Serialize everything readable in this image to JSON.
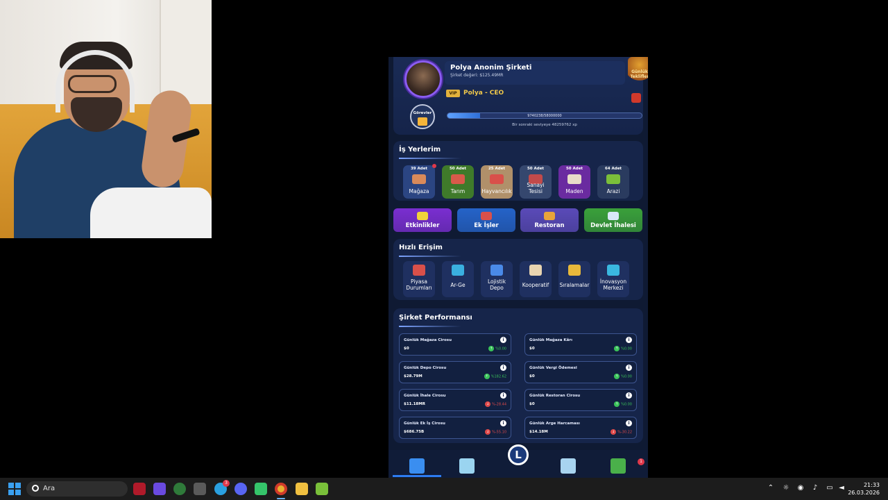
{
  "game": {
    "company_name": "Polya Anonim Şirketi",
    "company_value": "Şirket değeri: $125.49MR",
    "vip": "VIP",
    "ceo": "Polya - CEO",
    "daily_offers": "Günlük Teklifler",
    "tasks": "Görevler",
    "xp_progress": "9740238/58000000",
    "xp_fill_fraction": 0.168,
    "xp_next": "Bir sonraki seviyeye 48259762 xp",
    "workplaces_title": "İş Yerlerim",
    "workplaces": [
      {
        "count": "39 Adet",
        "label": "Mağaza",
        "color": "#2b4582",
        "icon_color": "#d98a5a",
        "alert": true
      },
      {
        "count": "50 Adet",
        "label": "Tarım",
        "color": "#3f7a2a",
        "icon_color": "#d95a4a",
        "alert": false
      },
      {
        "count": "25 Adet",
        "label": "Hayvancılık",
        "color": "#b0906a",
        "icon_color": "#d9504a",
        "alert": false
      },
      {
        "count": "50 Adet",
        "label": "Sanayi Tesisi",
        "color": "#35476e",
        "icon_color": "#c24a4a",
        "alert": false
      },
      {
        "count": "50 Adet",
        "label": "Maden",
        "color": "#6a2ba0",
        "icon_color": "#e8dcc8",
        "alert": false
      },
      {
        "count": "64 Adet",
        "label": "Arazi",
        "color": "#2a3b5f",
        "icon_color": "#7bbf3a",
        "alert": false
      }
    ],
    "features": [
      {
        "label": "Etkinlikler",
        "color": "#7a2ed0",
        "icon_color": "#f0d23a"
      },
      {
        "label": "Ek İşler",
        "color": "#2563c8",
        "icon_color": "#d9504a"
      },
      {
        "label": "Restoran",
        "color": "#5a4ab8",
        "icon_color": "#e8a43a"
      },
      {
        "label": "Devlet İhalesi",
        "color": "#3aa03a",
        "icon_color": "#d8e8f8"
      }
    ],
    "quick_title": "Hızlı Erişim",
    "quick": [
      {
        "label": "Piyasa Durumları",
        "icon_color": "#d9504a"
      },
      {
        "label": "Ar-Ge",
        "icon_color": "#3ab0e0"
      },
      {
        "label": "Lojistik Depo",
        "icon_color": "#4a8ae8"
      },
      {
        "label": "Kooperatif",
        "icon_color": "#e8d4b0"
      },
      {
        "label": "Sıralamalar",
        "icon_color": "#e8b83a"
      },
      {
        "label": "İnovasyon Merkezi",
        "icon_color": "#3ab8e0"
      }
    ],
    "perf_title": "Şirket Performansı",
    "stats": [
      {
        "title": "Günlük Mağaza Cirosu",
        "value": "$0",
        "change": "%0.00",
        "trend": "up"
      },
      {
        "title": "Günlük Mağaza Kârı",
        "value": "$0",
        "change": "%0.00",
        "trend": "up"
      },
      {
        "title": "Günlük Depo Cirosu",
        "value": "$28.79M",
        "change": "%182.62",
        "trend": "up"
      },
      {
        "title": "Günlük Vergi Ödemesi",
        "value": "$0",
        "change": "%0.00",
        "trend": "up"
      },
      {
        "title": "Günlük İhale Cirosu",
        "value": "$11.18MR",
        "change": "%-28.44",
        "trend": "down"
      },
      {
        "title": "Günlük Restoran Cirosu",
        "value": "$0",
        "change": "%0.00",
        "trend": "up"
      },
      {
        "title": "Günlük Ek İş Cirosu",
        "value": "$686.75B",
        "change": "%-55.10",
        "trend": "down"
      },
      {
        "title": "Günlük Arge Harcaması",
        "value": "$14.18M",
        "change": "%-30.22",
        "trend": "down"
      }
    ],
    "nav_center": "L",
    "nav_badge": "1"
  },
  "taskbar": {
    "search_placeholder": "Ara",
    "telegram_badge": "3",
    "time": "21:33",
    "date": "26.03.2026"
  },
  "colors": {
    "up": "#3ac35a",
    "down": "#e04a4a"
  }
}
